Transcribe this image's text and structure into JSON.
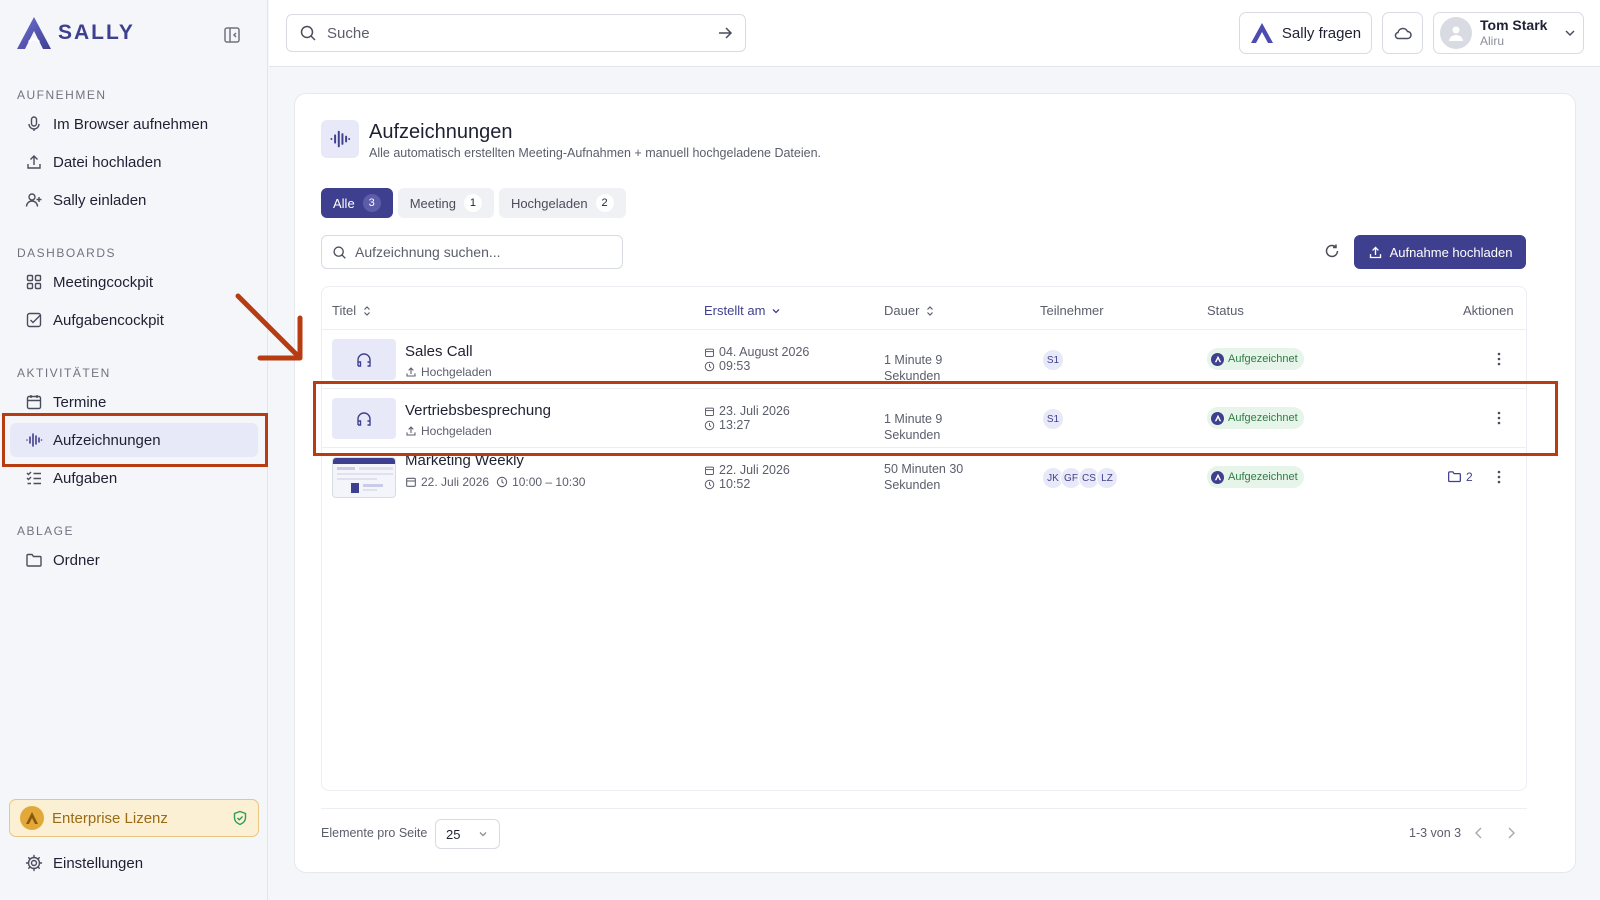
{
  "app": {
    "name": "SALLY"
  },
  "sidebar": {
    "sections": [
      {
        "label": "AUFNEHMEN",
        "items": [
          {
            "label": "Im Browser aufnehmen",
            "icon": "mic-icon"
          },
          {
            "label": "Datei hochladen",
            "icon": "upload-icon"
          },
          {
            "label": "Sally einladen",
            "icon": "user-plus-icon"
          }
        ]
      },
      {
        "label": "DASHBOARDS",
        "items": [
          {
            "label": "Meetingcockpit",
            "icon": "grid-icon"
          },
          {
            "label": "Aufgabencockpit",
            "icon": "check-square-icon"
          }
        ]
      },
      {
        "label": "AKTIVITÄTEN",
        "items": [
          {
            "label": "Termine",
            "icon": "calendar-icon"
          },
          {
            "label": "Aufzeichnungen",
            "icon": "waveform-icon",
            "active": true
          },
          {
            "label": "Aufgaben",
            "icon": "list-check-icon"
          }
        ]
      },
      {
        "label": "ABLAGE",
        "items": [
          {
            "label": "Ordner",
            "icon": "folder-icon"
          }
        ]
      }
    ],
    "license": "Enterprise Lizenz",
    "settings": "Einstellungen"
  },
  "topbar": {
    "search_placeholder": "Suche",
    "ask_label": "Sally fragen",
    "user": {
      "name": "Tom Stark",
      "org": "Aliru"
    }
  },
  "page": {
    "title": "Aufzeichnungen",
    "subtitle": "Alle automatisch erstellten Meeting-Aufnahmen + manuell hochgeladene Dateien.",
    "tabs": [
      {
        "label": "Alle",
        "count": "3",
        "active": true
      },
      {
        "label": "Meeting",
        "count": "1"
      },
      {
        "label": "Hochgeladen",
        "count": "2"
      }
    ],
    "search_placeholder": "Aufzeichnung suchen...",
    "upload_label": "Aufnahme hochladen"
  },
  "table": {
    "columns": {
      "title": "Titel",
      "created": "Erstellt am",
      "duration": "Dauer",
      "participants": "Teilnehmer",
      "status": "Status",
      "actions": "Aktionen"
    },
    "rows": [
      {
        "title": "Sales Call",
        "sub": "Hochgeladen",
        "date": "04. August 2026",
        "time": "09:53",
        "duration": "1 Minute 9 Sekunden",
        "participants": [
          "S1"
        ],
        "status": "Aufgezeichnet"
      },
      {
        "title": "Vertriebsbesprechung",
        "sub": "Hochgeladen",
        "date": "23. Juli 2026",
        "time": "13:27",
        "duration": "1 Minute 9 Sekunden",
        "participants": [
          "S1"
        ],
        "status": "Aufgezeichnet"
      },
      {
        "title": "Marketing Weekly",
        "sub_date": "22. Juli 2026",
        "sub_time": "10:00 – 10:30",
        "date": "22. Juli 2026",
        "time": "10:52",
        "duration": "50 Minuten 30 Sekunden",
        "participants": [
          "JK",
          "GF",
          "CS",
          "LZ"
        ],
        "status": "Aufgezeichnet",
        "folder_count": "2"
      }
    ]
  },
  "pagination": {
    "per_page_label": "Elemente pro Seite",
    "per_page": "25",
    "range": "1-3 von 3"
  },
  "colors": {
    "accent": "#3f3f8f",
    "annotation": "#b83c12",
    "status_bg": "#e6f4ea"
  }
}
